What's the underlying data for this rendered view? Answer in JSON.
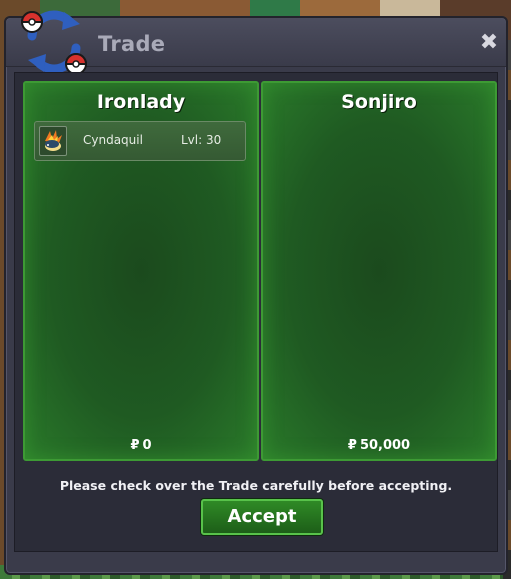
{
  "window": {
    "title": "Trade",
    "close_icon": "✖"
  },
  "left_player": {
    "name": "Ironlady",
    "items": [
      {
        "name": "Cyndaquil",
        "level": "Lvl: 30",
        "icon": "cyndaquil-sprite-icon"
      }
    ],
    "money_symbol": "₽",
    "money": "0"
  },
  "right_player": {
    "name": "Sonjiro",
    "items": [],
    "money_symbol": "₽",
    "money": "50,000"
  },
  "notice": "Please check over the Trade carefully before accepting.",
  "accept_label": "Accept",
  "colors": {
    "panel_green": "#1f5a22",
    "panel_border": "#3d9a34",
    "dialog_bg": "#3a3b4a",
    "accept_green": "#2f8a26"
  }
}
